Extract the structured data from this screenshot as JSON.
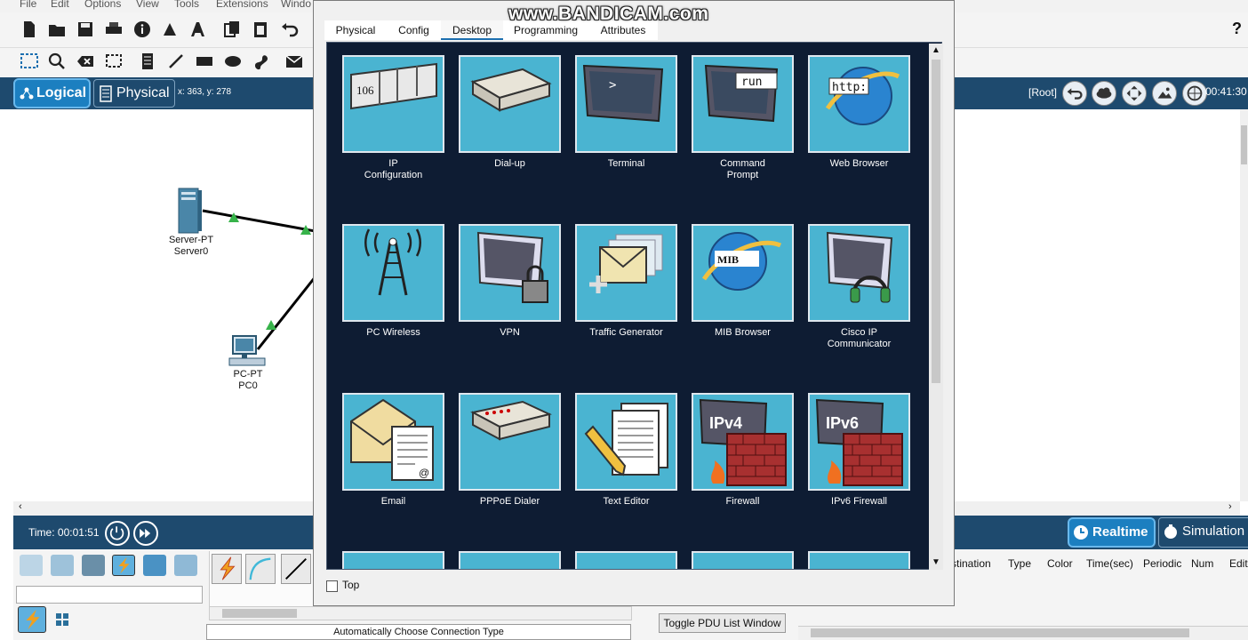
{
  "menu": [
    "File",
    "Edit",
    "Options",
    "View",
    "Tools",
    "Extensions",
    "Windo"
  ],
  "help_glyph": "?",
  "workspace_bar": {
    "logical_label": "Logical",
    "physical_label": "Physical",
    "coordinates": "x: 363, y: 278",
    "root_label": "[Root]",
    "clock": "00:41:30"
  },
  "devices": [
    {
      "type": "Server-PT",
      "name": "Server0"
    },
    {
      "type": "PC-PT",
      "name": "PC0"
    }
  ],
  "time_bar": {
    "time_label": "Time: 00:01:51",
    "realtime_label": "Realtime",
    "simulation_label": "Simulation"
  },
  "bottom": {
    "connection_type": "Automatically Choose Connection Type",
    "pdu_button": "Toggle PDU List Window",
    "pdu_columns": [
      "stination",
      "Type",
      "Color",
      "Time(sec)",
      "Periodic",
      "Num",
      "Edit"
    ]
  },
  "dialog": {
    "tabs": [
      "Physical",
      "Config",
      "Desktop",
      "Programming",
      "Attributes"
    ],
    "active_tab": "Desktop",
    "apps": [
      {
        "label": "IP\nConfiguration",
        "icon": "ip-configuration-icon",
        "glyph": "106"
      },
      {
        "label": "Dial-up",
        "icon": "dial-up-icon"
      },
      {
        "label": "Terminal",
        "icon": "terminal-icon",
        "glyph": ">"
      },
      {
        "label": "Command\nPrompt",
        "icon": "command-prompt-icon",
        "glyph": "run"
      },
      {
        "label": "Web Browser",
        "icon": "web-browser-icon",
        "glyph": "http:"
      },
      {
        "label": "PC Wireless",
        "icon": "pc-wireless-icon"
      },
      {
        "label": "VPN",
        "icon": "vpn-icon"
      },
      {
        "label": "Traffic Generator",
        "icon": "traffic-generator-icon"
      },
      {
        "label": "MIB Browser",
        "icon": "mib-browser-icon",
        "glyph": "MIB"
      },
      {
        "label": "Cisco IP\nCommunicator",
        "icon": "cisco-ip-communicator-icon"
      },
      {
        "label": "Email",
        "icon": "email-icon"
      },
      {
        "label": "PPPoE Dialer",
        "icon": "pppoe-dialer-icon"
      },
      {
        "label": "Text Editor",
        "icon": "text-editor-icon"
      },
      {
        "label": "Firewall",
        "icon": "firewall-icon",
        "glyph": "IPv4"
      },
      {
        "label": "IPv6 Firewall",
        "icon": "ipv6-firewall-icon",
        "glyph": "IPv6"
      }
    ],
    "top_checkbox_label": "Top"
  },
  "watermark": "www.BANDICAM.com",
  "colors": {
    "dark_blue": "#1e4a6e",
    "accent": "#1c7fc0",
    "tile": "#4ab4d1",
    "desktop_bg": "#0e1c33"
  }
}
